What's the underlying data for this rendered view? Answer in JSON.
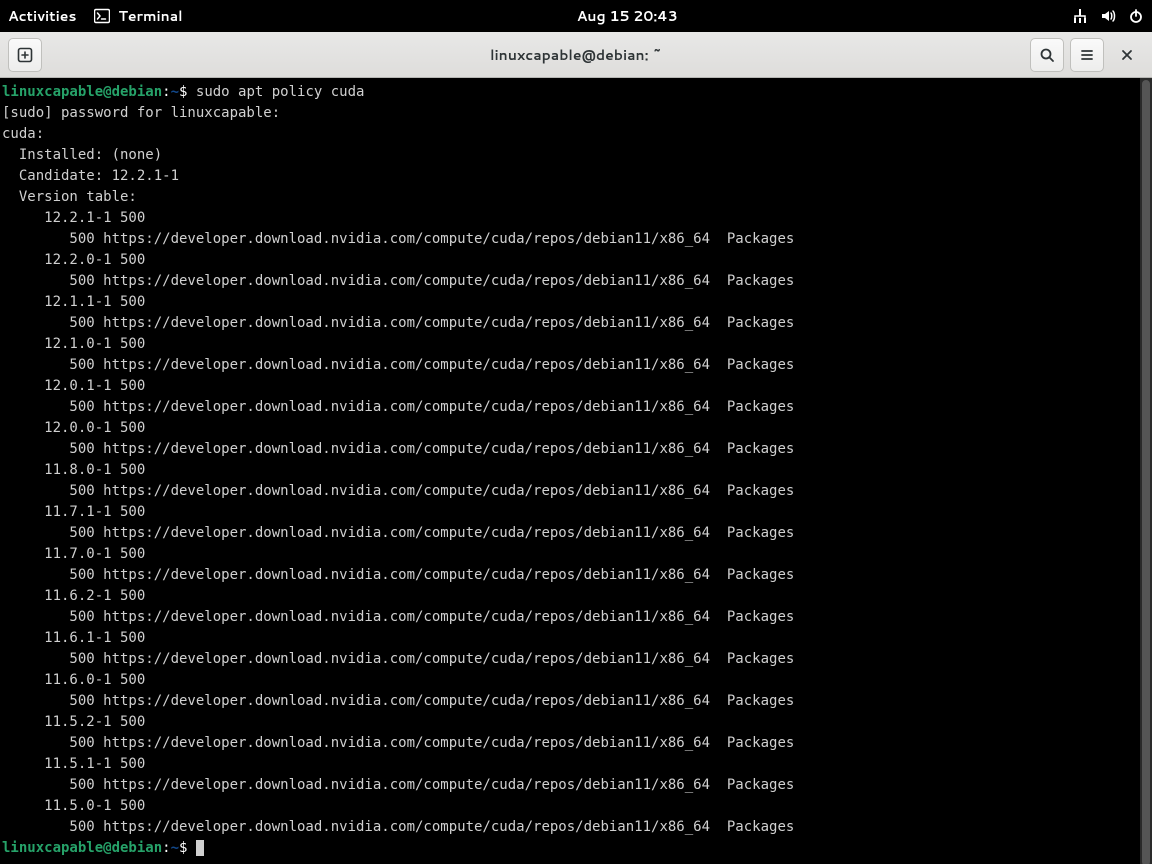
{
  "panel": {
    "activities": "Activities",
    "app_name": "Terminal",
    "clock": "Aug 15  20:43"
  },
  "headerbar": {
    "title": "linuxcapable@debian: ~"
  },
  "prompt": {
    "user_host": "linuxcapable@debian",
    "sep": ":",
    "cwd": "~",
    "sigil": "$"
  },
  "command1": "sudo apt policy cuda",
  "static_lines": [
    "[sudo] password for linuxcapable: ",
    "cuda:",
    "  Installed: (none)",
    "  Candidate: 12.2.1-1",
    "  Version table:"
  ],
  "repo_line": "        500 https://developer.download.nvidia.com/compute/cuda/repos/debian11/x86_64  Packages",
  "versions": [
    "12.2.1-1",
    "12.2.0-1",
    "12.1.1-1",
    "12.1.0-1",
    "12.0.1-1",
    "12.0.0-1",
    "11.8.0-1",
    "11.7.1-1",
    "11.7.0-1",
    "11.6.2-1",
    "11.6.1-1",
    "11.6.0-1",
    "11.5.2-1",
    "11.5.1-1",
    "11.5.0-1"
  ]
}
